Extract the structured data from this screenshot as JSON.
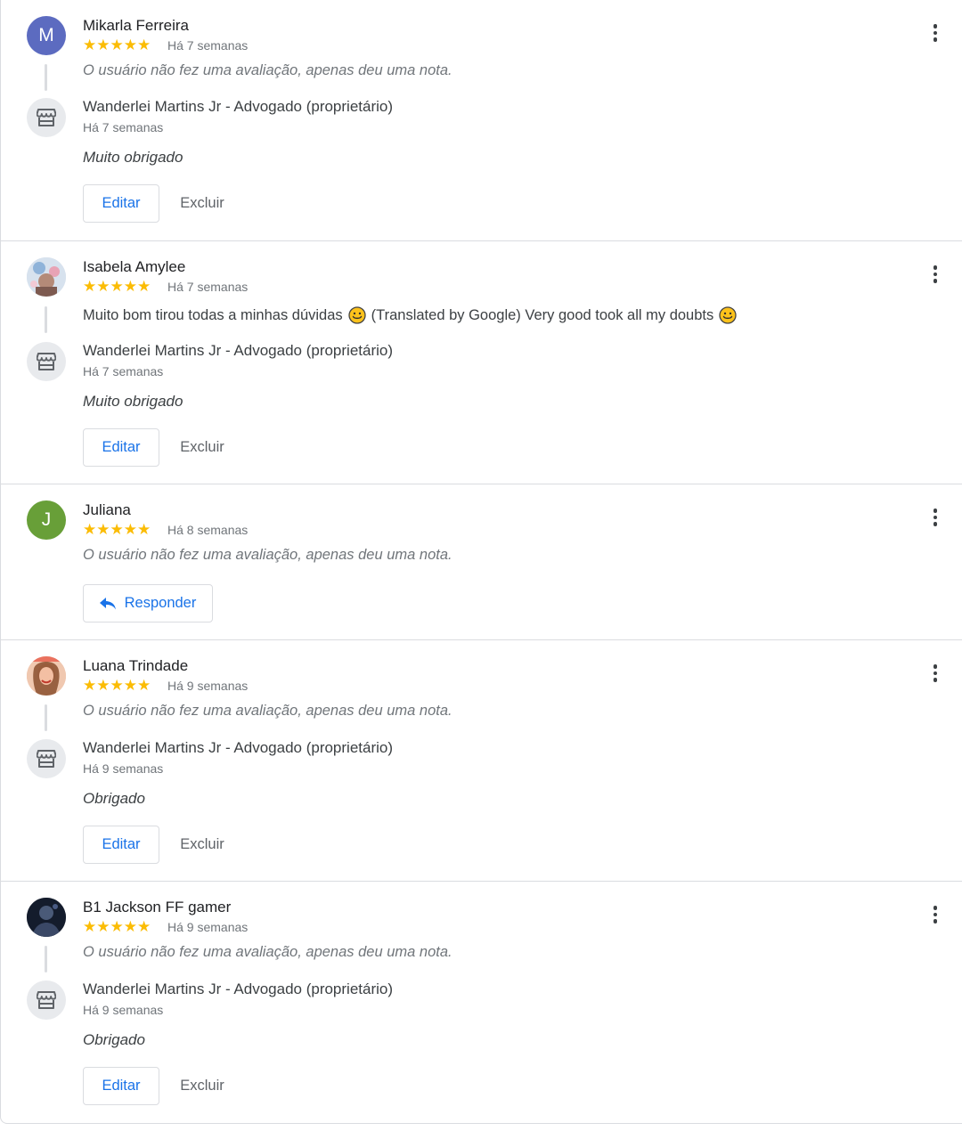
{
  "reviews": [
    {
      "name": "Mikarla Ferreira",
      "initial": "M",
      "avatar_color": "#5c6bc0",
      "stars": "★★★★★",
      "date": "Há 7 semanas",
      "comment": "O usuário não fez uma avaliação, apenas deu uma nota.",
      "owner_name": "Wanderlei Martins Jr - Advogado (proprietário)",
      "owner_date": "Há 7 semanas",
      "reply": "Muito obrigado",
      "edit_label": "Editar",
      "delete_label": "Excluir"
    },
    {
      "name": "Isabela Amylee",
      "stars": "★★★★★",
      "date": "Há 7 semanas",
      "comment_part1": "Muito bom tirou todas a minhas dúvidas",
      "comment_part2": "(Translated by Google) Very good took all my doubts",
      "owner_name": "Wanderlei Martins Jr - Advogado (proprietário)",
      "owner_date": "Há 7 semanas",
      "reply": "Muito obrigado",
      "edit_label": "Editar",
      "delete_label": "Excluir"
    },
    {
      "name": "Juliana",
      "initial": "J",
      "avatar_color": "#689f38",
      "stars": "★★★★★",
      "date": "Há 8 semanas",
      "comment": "O usuário não fez uma avaliação, apenas deu uma nota.",
      "respond_label": "Responder"
    },
    {
      "name": "Luana Trindade",
      "stars": "★★★★★",
      "date": "Há 9 semanas",
      "comment": "O usuário não fez uma avaliação, apenas deu uma nota.",
      "owner_name": "Wanderlei Martins Jr - Advogado (proprietário)",
      "owner_date": "Há 9 semanas",
      "reply": "Obrigado",
      "edit_label": "Editar",
      "delete_label": "Excluir"
    },
    {
      "name": "B1 Jackson FF gamer",
      "stars": "★★★★★",
      "date": "Há 9 semanas",
      "comment": "O usuário não fez uma avaliação, apenas deu uma nota.",
      "owner_name": "Wanderlei Martins Jr - Advogado (proprietário)",
      "owner_date": "Há 9 semanas",
      "reply": "Obrigado",
      "edit_label": "Editar",
      "delete_label": "Excluir"
    }
  ],
  "colors": {
    "accent": "#1a73e8",
    "star": "#fbbc04",
    "divider": "#dadce0"
  },
  "icons": {
    "owner": "storefront-icon",
    "more": "more-vertical-icon",
    "reply": "reply-arrow-icon",
    "emoji": "slightly-smiling-face-emoji"
  }
}
